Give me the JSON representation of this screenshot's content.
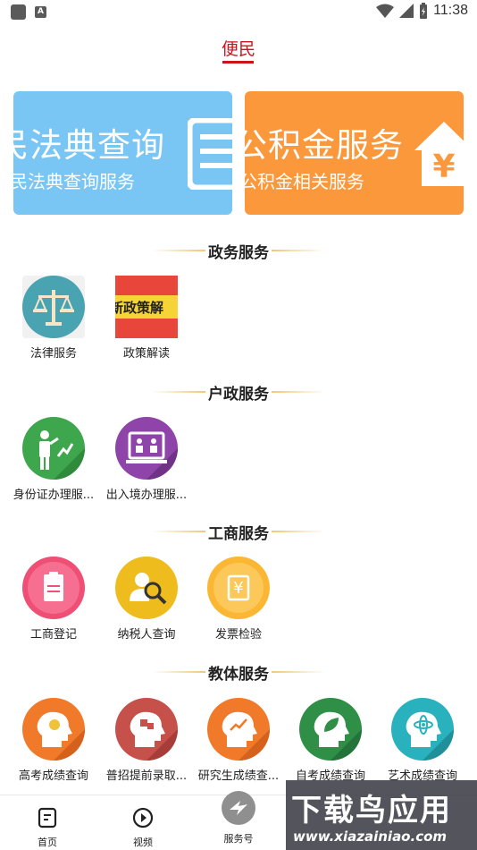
{
  "status_bar": {
    "time": "11:38"
  },
  "header": {
    "title": "便民"
  },
  "banners": [
    {
      "title": "民法典查询",
      "subtitle": "民法典查询服务"
    },
    {
      "title": "公积金服务",
      "subtitle": "公积金相关服务"
    }
  ],
  "sections": [
    {
      "title": "政务服务",
      "items": [
        {
          "label": "法律服务"
        },
        {
          "label": "政策解读",
          "image_text": "新政策解"
        }
      ]
    },
    {
      "title": "户政服务",
      "items": [
        {
          "label": "身份证办理服..."
        },
        {
          "label": "出入境办理服..."
        }
      ]
    },
    {
      "title": "工商服务",
      "items": [
        {
          "label": "工商登记"
        },
        {
          "label": "纳税人查询"
        },
        {
          "label": "发票检验"
        }
      ]
    },
    {
      "title": "教体服务",
      "items": [
        {
          "label": "高考成绩查询"
        },
        {
          "label": "普招提前录取..."
        },
        {
          "label": "研究生成绩查..."
        },
        {
          "label": "自考成绩查询"
        },
        {
          "label": "艺术成绩查询"
        }
      ]
    }
  ],
  "bottom_nav": [
    {
      "label": "首页"
    },
    {
      "label": "视频"
    },
    {
      "label": "服务号"
    }
  ],
  "watermark": {
    "title": "下载鸟应用",
    "url": "www.xiazainiao.com"
  },
  "colors": {
    "accent": "#d0121b",
    "banner_blue": "#79c6f5",
    "banner_orange": "#fb983b"
  }
}
